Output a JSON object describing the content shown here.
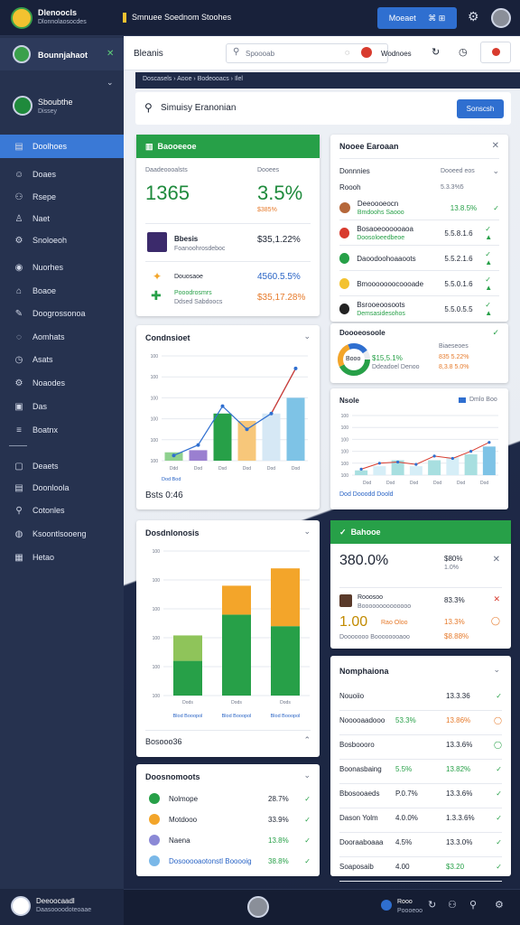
{
  "app": {
    "title": "Dlenoocls",
    "subtitle": "Dlonnolaosocdes",
    "center_title": "Smnuee Soednom Stoohes",
    "primary_button": "Moeaet",
    "primary_button_icons": "⌘ ⊞"
  },
  "sidebar": {
    "header": "Bounnjahaot",
    "user": {
      "name": "Sboubthe",
      "role": "Dissey"
    },
    "items": [
      {
        "label": "Doolhoes",
        "icon": "grid-icon",
        "glyph": "▤",
        "active": true
      },
      {
        "label": "Doaes",
        "icon": "users-icon",
        "glyph": "☺"
      },
      {
        "label": "Rsepe",
        "icon": "people-icon",
        "glyph": "⚇"
      },
      {
        "label": "Naet",
        "icon": "person-icon",
        "glyph": "♙"
      },
      {
        "label": "Snoloeoh",
        "icon": "gear-icon",
        "glyph": "⚙"
      },
      {
        "label": "Nuorhes",
        "icon": "globe-icon",
        "glyph": "◉"
      },
      {
        "label": "Boaoe",
        "icon": "lock-icon",
        "glyph": "⌂"
      },
      {
        "label": "Doogrossonoa",
        "icon": "pen-icon",
        "glyph": "✎"
      },
      {
        "label": "Aomhats",
        "icon": "chat-icon",
        "glyph": "◌"
      },
      {
        "label": "Asats",
        "icon": "clock-icon",
        "glyph": "◷"
      },
      {
        "label": "Noaodes",
        "icon": "settings-icon",
        "glyph": "⚙"
      },
      {
        "label": "Das",
        "icon": "image-icon",
        "glyph": "▣"
      },
      {
        "label": "Boatnx",
        "icon": "list-icon",
        "glyph": "≡"
      },
      {
        "label": "Deaets",
        "icon": "file-icon",
        "glyph": "▢"
      },
      {
        "label": "Doonloola",
        "icon": "copy-icon",
        "glyph": "▤"
      },
      {
        "label": "Cotonles",
        "icon": "search-icon",
        "glyph": "⚲"
      },
      {
        "label": "Ksoontlsooeng",
        "icon": "globe-icon",
        "glyph": "◍"
      },
      {
        "label": "Hetao",
        "icon": "grid-icon",
        "glyph": "▦"
      }
    ],
    "footer": {
      "name": "Deeoocaadl",
      "sub": "Daasoooodoteoaae"
    }
  },
  "header": {
    "page_title": "Bleanis",
    "search_placeholder": "Spoooab",
    "toggle_label": "Wodnoes",
    "breadcrumb": "Doscasels  ›  Aooe  ›  Bodeooacs  ›  Ilel",
    "section_title": "Simuisy Eranonian",
    "action_button": "Sonscsh"
  },
  "kpi": {
    "title": "Baooeeoe",
    "col1_label": "Daadeoooalsts",
    "col2_label": "Dooees",
    "big1": "1365",
    "big2": "3.5%",
    "big2_sub": "$385%",
    "r1_label": "Bbesis",
    "r1_sub": "Foanoohrosdeboc",
    "r1_value": "$35,1.22%",
    "r2_label": "Douosaoe",
    "r2_value": "4560.5.5%",
    "r3_label": "Pooodrosmrs",
    "r3_sub": "Ddsed Sabdoocs",
    "r3_value": "$35,17.28%"
  },
  "recent": {
    "title": "Nooee Earoaan",
    "col1": "Donnnies",
    "col2": "Dooeed eos",
    "sub": "Roooh",
    "sub2": "5.3.3%5",
    "rows": [
      {
        "name": "Deeoooeocn",
        "sub": "Bmdoohs Saooo",
        "value": "13.8.5%",
        "check": "✓"
      },
      {
        "name": "Bosaoeoooooaoa",
        "sub": "Doosoloeedbeoe",
        "value": "5.5.8.1.6",
        "check": "✓ ▲"
      },
      {
        "name": "Daoodoohoaaoots",
        "sub": "",
        "value": "5.5.2.1.6",
        "check": "✓ ▲"
      },
      {
        "name": "Bmooooooocoooade",
        "sub": "",
        "value": "5.5.0.1.6",
        "check": "✓ ▲"
      },
      {
        "name": "Bsrooeoosoots",
        "sub": "Demsasidesohos",
        "value": "5.5.0.5.5",
        "check": "✓ ▲"
      }
    ]
  },
  "donut": {
    "title": "Doooeosoole",
    "center": "Booo",
    "value": "$15,5.1%",
    "sub": "Ddeadoel Denoo",
    "right_label": "Biaeseoes",
    "right_v1": "835 5.22%",
    "right_v2": "8,3.8 5.0%"
  },
  "chart1": {
    "title": "Condnsioet",
    "summary": "Bsts 0:46",
    "chart_data": {
      "type": "bar",
      "series": [
        {
          "values": [
            8,
            10,
            45,
            38,
            45,
            60
          ]
        }
      ],
      "line": [
        5,
        15,
        52,
        30,
        45,
        88
      ],
      "xticks": [
        "Ddd",
        "Dod",
        "Dsd",
        "Dod",
        "Dod",
        "Dod"
      ],
      "yticks": [
        "100",
        "100",
        "100",
        "100",
        "100",
        "100"
      ],
      "legend": "Dod Bod",
      "ylim": [
        0,
        100
      ]
    }
  },
  "chart2": {
    "title": "Nsole",
    "legend": "Dmlo Boo",
    "legend_bottom": "Dod Dooodd     Doold",
    "chart_data": {
      "type": "bar",
      "values": [
        8,
        15,
        25,
        15,
        25,
        30,
        35,
        48
      ],
      "line": [
        10,
        20,
        22,
        18,
        32,
        28,
        40,
        55
      ],
      "xticks": [
        "Dod",
        "Dod",
        "Dod",
        "Dod",
        "Dod",
        "Dod"
      ],
      "yticks": [
        "100",
        "100",
        "100",
        "100",
        "100",
        "100"
      ],
      "ylim": [
        0,
        100
      ]
    }
  },
  "chart3": {
    "title": "Dosdnlonosis",
    "chart_data": {
      "type": "bar",
      "categories": [
        "Dods",
        "Dods",
        "Dods"
      ],
      "stack_green": [
        30,
        70,
        60
      ],
      "stack_top": [
        22,
        25,
        50
      ],
      "top_colors": [
        "#8fc45a",
        "#f3a52a",
        "#f3a52a"
      ],
      "yticks": [
        "100",
        "100",
        "100",
        "100",
        "100",
        "100"
      ],
      "legend": [
        "Blod Booopol",
        "Blod Booopol",
        "Blod Booopol"
      ],
      "ylim": [
        0,
        125
      ]
    },
    "footer": "Bosooo36"
  },
  "breakdown": {
    "title": "Doosnomoots",
    "rows": [
      {
        "name": "Nolmope",
        "value": "28.7%",
        "color": "#27a048"
      },
      {
        "name": "Motdooo",
        "value": "33.9%",
        "color": "#f3a52a"
      },
      {
        "name": "Naena",
        "value": "13.8%",
        "color": "#8b89d6"
      },
      {
        "name": "Dosooooaotonstl Booooig",
        "value": "38.8%",
        "color": "#7ab8e8"
      }
    ]
  },
  "alerts": {
    "title": "Bahooe",
    "big": "380.0%",
    "big_right": "$80%",
    "big_right2": "1.0%",
    "r1_name": "Rooosoo",
    "r1_sub": "Boooooooooooooo",
    "r1_value": "83.3%",
    "r2_big": "1.00",
    "r2_tag": "Rao Oloo",
    "r2_value": "13.3%",
    "r3_sub": "Dooooooo Boooooooaoo",
    "r3_value": "$8.88%"
  },
  "activity": {
    "title": "Nomphaiona",
    "rows": [
      {
        "name": "Nouoiio",
        "mid": "",
        "value": "13.3.36",
        "check": "✓"
      },
      {
        "name": "Nooooaadooo",
        "mid": "53.3%",
        "value": "13.86%",
        "check": "◯"
      },
      {
        "name": "Bosboooro",
        "mid": "",
        "value": "13.3.6%",
        "check": "◯"
      },
      {
        "name": "Boonasbaing",
        "mid": "5.5%",
        "value": "13.82%",
        "check": "✓"
      },
      {
        "name": "Bbosooaeds",
        "mid": "P.0.7%",
        "value": "13.3.6%",
        "check": "✓"
      },
      {
        "name": "Dason Yolm",
        "mid": "4.0.0%",
        "value": "1.3.3.6%",
        "check": "✓"
      },
      {
        "name": "Dooraaboaaa",
        "mid": "4.5%",
        "value": "13.3.0%",
        "check": "✓"
      },
      {
        "name": "Soaposaib",
        "mid": "4.00",
        "value": "$3.20",
        "check": "✓"
      }
    ]
  },
  "bottom": {
    "status": "Rooo",
    "status_sub": "Poooeoo"
  }
}
